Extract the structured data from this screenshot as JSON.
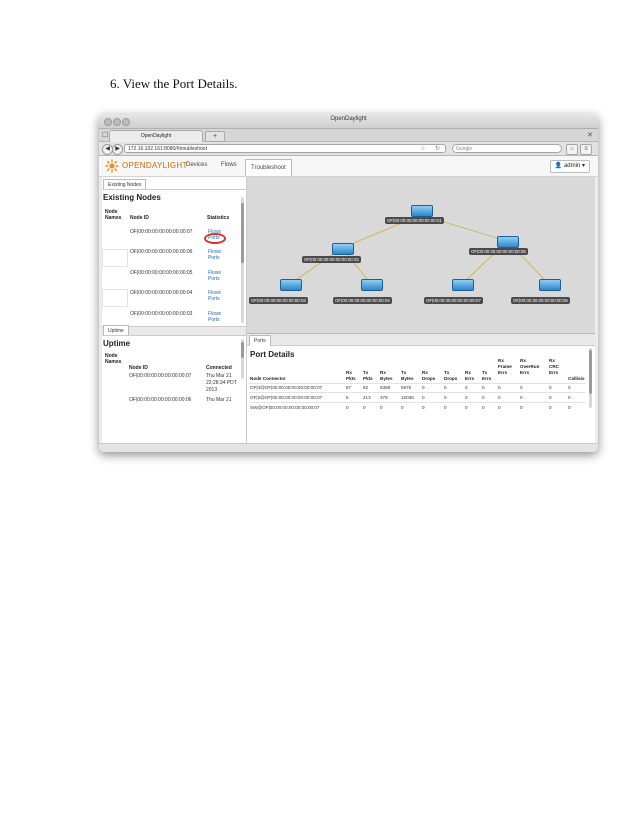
{
  "document": {
    "step_heading": "6. View the Port Details."
  },
  "window": {
    "title": "OpenDaylight",
    "tab_title": "OpenDaylight",
    "new_tab_label": "+",
    "url": "172.16.102.161:8080/#troubleshoot",
    "search_placeholder": "Google"
  },
  "app": {
    "brand": "OPENDAYLIGHT",
    "tabs": [
      "Devices",
      "Flows",
      "Troubleshoot"
    ],
    "user": "admin"
  },
  "existing_nodes": {
    "tab_label": "Existing Nodes",
    "title": "Existing Nodes",
    "headers": {
      "names": "Node Names",
      "id": "Node ID",
      "stats": "Statistics"
    },
    "rows": [
      {
        "node_id": "OF|00:00:00:00:00:00:00:07",
        "links": [
          "Flows",
          "Ports"
        ]
      },
      {
        "node_id": "OF|00:00:00:00:00:00:00:06",
        "links": [
          "Flows",
          "Ports"
        ]
      },
      {
        "node_id": "OF|00:00:00:00:00:00:00:05",
        "links": [
          "Flows",
          "Ports"
        ]
      },
      {
        "node_id": "OF|00:00:00:00:00:00:00:04",
        "links": [
          "Flows",
          "Ports"
        ]
      },
      {
        "node_id": "OF|00:00:00:00:00:00:00:03",
        "links": [
          "Flows",
          "Ports"
        ]
      }
    ]
  },
  "uptime": {
    "tab_label": "Uptime",
    "title": "Uptime",
    "headers": {
      "names": "Node Names",
      "id": "Node ID",
      "connected": "Connected"
    },
    "rows": [
      {
        "node_id": "OF|00:00:00:00:00:00:00:07",
        "connected": "Thu Mar 21 22:28:34 PDT 2013"
      },
      {
        "node_id": "OF|00:00:00:00:00:00:00:06",
        "connected": "Thu Mar 21"
      }
    ]
  },
  "topology": {
    "nodes": [
      {
        "id": "OF|00:00:00:00:00:00:00:01"
      },
      {
        "id": "OF|00:00:00:00:00:00:00:02"
      },
      {
        "id": "OF|00:00:00:00:00:00:00:05"
      },
      {
        "id": "OF|00:00:00:00:00:00:00:03"
      },
      {
        "id": "OF|00:00:00:00:00:00:00:04"
      },
      {
        "id": "OF|00:00:00:00:00:00:00:07"
      },
      {
        "id": "OF|00:00:00:00:00:00:00:06"
      }
    ],
    "link_color": "#c9b64a"
  },
  "port_details": {
    "tab_label": "Ports",
    "title": "Port Details",
    "headers": [
      "Node Connector",
      "Rx Pkts",
      "Tx Pkts",
      "Rx Bytes",
      "Tx Bytes",
      "Rx Drops",
      "Tx Drops",
      "Rx Errs",
      "Tx Errs",
      "Rx Frame Errs",
      "Rx OverRun Errs",
      "Rx CRC Errs",
      "Collisio"
    ],
    "rows": [
      [
        "OF|3@OF|00:00:00:00:00:00:00:07",
        "87",
        "82",
        "6356",
        "5976",
        "0",
        "0",
        "0",
        "0",
        "0",
        "0",
        "0",
        "0"
      ],
      [
        "OF|2@OF|00:00:00:00:00:00:00:07",
        "5",
        "213",
        "378",
        "15036",
        "0",
        "0",
        "0",
        "0",
        "0",
        "0",
        "0",
        "0"
      ],
      [
        "SW@OF|00:00:00:00:00:00:00:07",
        "0",
        "0",
        "0",
        "0",
        "0",
        "0",
        "0",
        "0",
        "0",
        "0",
        "0",
        "0"
      ]
    ]
  },
  "colors": {
    "accent": "#c96a00",
    "link": "#2a66b6",
    "highlight": "#d9342b"
  },
  "icons": [
    "back-arrow-icon",
    "reload-icon",
    "home-icon",
    "user-icon",
    "logo-icon"
  ]
}
